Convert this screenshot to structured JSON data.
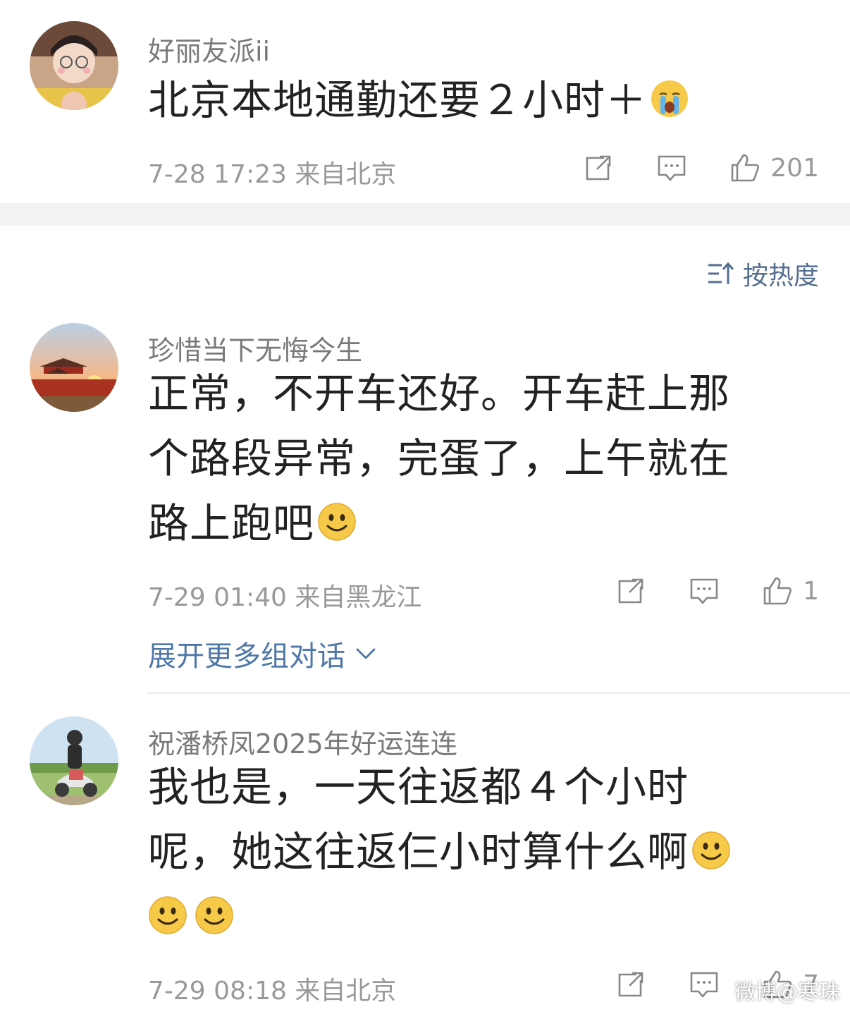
{
  "post": {
    "username": "好丽友派ii",
    "text": "北京本地通勤还要２小时＋",
    "emoji": "crying-face",
    "meta": "7-28 17:23  来自北京",
    "like_count": "201"
  },
  "sort": {
    "label": "按热度"
  },
  "comments": [
    {
      "username": "珍惜当下无悔今生",
      "lines": [
        "正常，不开车还好。开车赶上那",
        "个路段异常，完蛋了，上午就在",
        "路上跑吧"
      ],
      "meta": "7-29 01:40  来自黑龙江",
      "like_count": "1"
    },
    {
      "username": "祝潘桥凤2025年好运连连",
      "lines": [
        "我也是，一天往返都４个小时",
        "呢，她这往返仨小时算什么啊",
        ""
      ],
      "meta": "7-29 08:18  来自北京",
      "like_count": "7"
    }
  ],
  "expand": {
    "label": "展开更多组对话"
  },
  "watermark": "微博@寒珠",
  "colors": {
    "link": "#4f77a8",
    "sort": "#556e8f",
    "meta": "#999999",
    "band": "#f2f2f2"
  },
  "icons": [
    "share-icon",
    "reply-icon",
    "like-icon",
    "sort-icon",
    "chevron-down-icon",
    "smile-emoji",
    "crying-emoji"
  ]
}
